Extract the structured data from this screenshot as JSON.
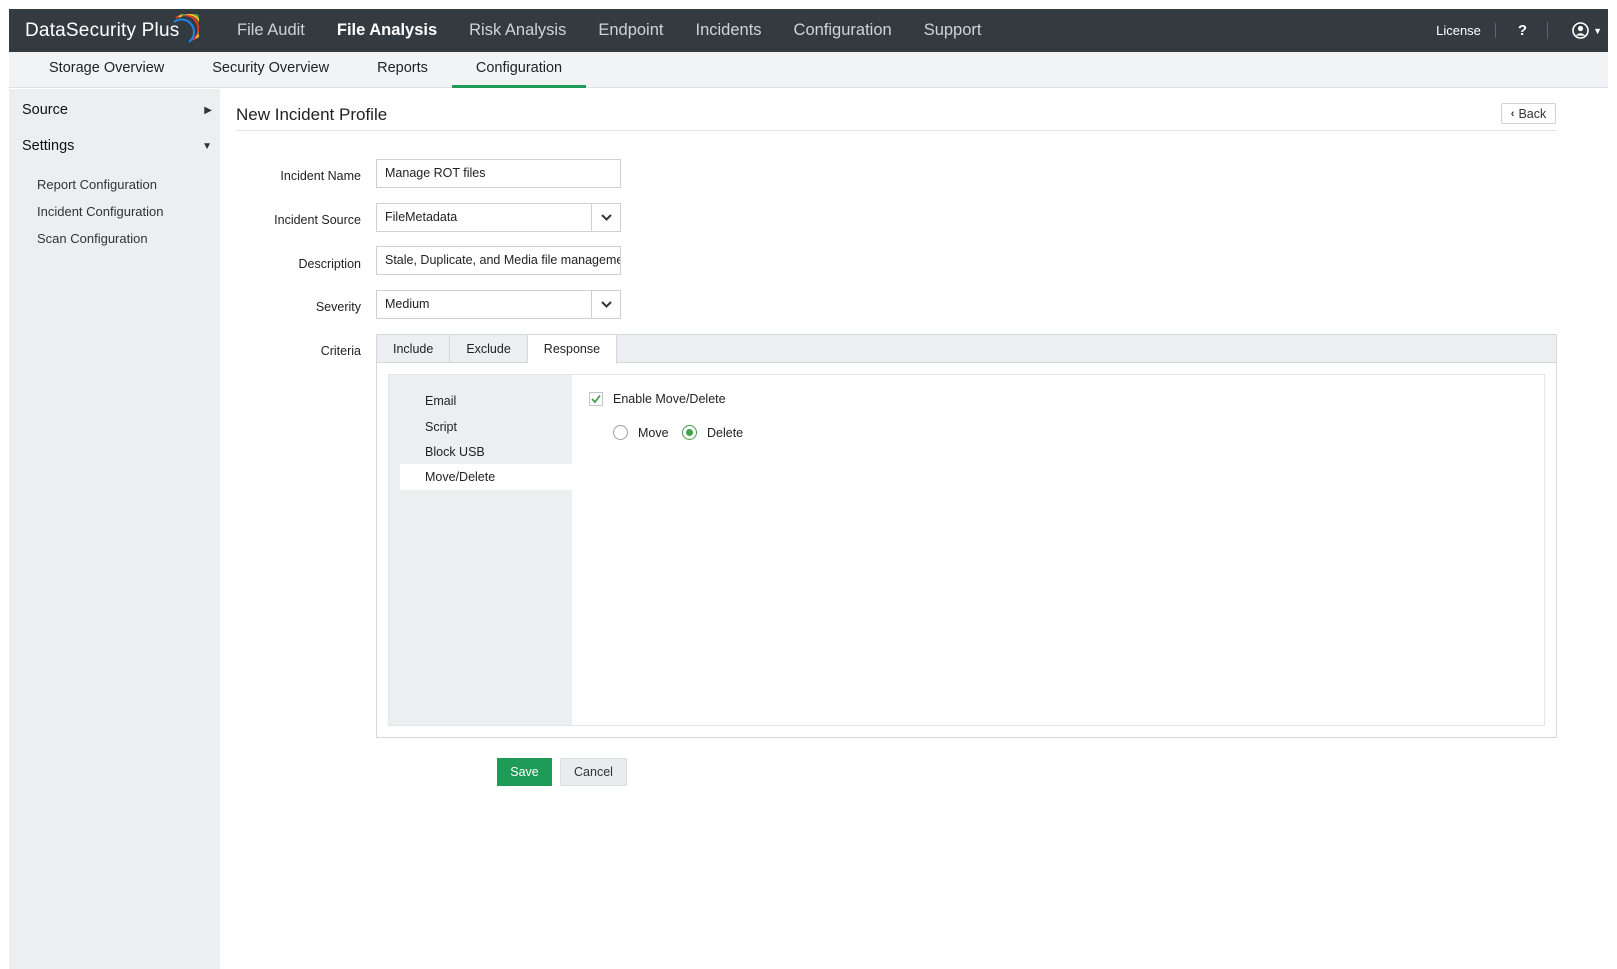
{
  "app": {
    "brand": "DataSecurity Plus"
  },
  "topnav": {
    "items": [
      {
        "label": "File Audit"
      },
      {
        "label": "File Analysis"
      },
      {
        "label": "Risk Analysis"
      },
      {
        "label": "Endpoint"
      },
      {
        "label": "Incidents"
      },
      {
        "label": "Configuration"
      },
      {
        "label": "Support"
      }
    ],
    "active": "File Analysis",
    "license": "License",
    "help": "?"
  },
  "subnav": {
    "items": [
      {
        "label": "Storage Overview"
      },
      {
        "label": "Security Overview"
      },
      {
        "label": "Reports"
      },
      {
        "label": "Configuration"
      }
    ],
    "active": "Configuration"
  },
  "sidebar": {
    "source": "Source",
    "settings": "Settings",
    "links": [
      {
        "label": "Report Configuration"
      },
      {
        "label": "Incident Configuration"
      },
      {
        "label": "Scan Configuration"
      }
    ]
  },
  "page": {
    "title": "New Incident Profile",
    "back": "Back"
  },
  "form": {
    "incident_name_label": "Incident Name",
    "incident_name_value": "Manage ROT files",
    "incident_source_label": "Incident Source",
    "incident_source_value": "FileMetadata",
    "description_label": "Description",
    "description_value": "Stale, Duplicate, and Media file management",
    "severity_label": "Severity",
    "severity_value": "Medium",
    "criteria_label": "Criteria"
  },
  "criteria": {
    "tabs": [
      {
        "label": "Include"
      },
      {
        "label": "Exclude"
      },
      {
        "label": "Response"
      }
    ],
    "active_tab": "Response",
    "responses": [
      {
        "label": "Email"
      },
      {
        "label": "Script"
      },
      {
        "label": "Block USB"
      },
      {
        "label": "Move/Delete"
      }
    ],
    "active_response": "Move/Delete",
    "enable_label": "Enable Move/Delete",
    "enable_checked": true,
    "move_label": "Move",
    "delete_label": "Delete",
    "selected_action": "Delete"
  },
  "actions": {
    "save": "Save",
    "cancel": "Cancel"
  },
  "colors": {
    "topbar": "#333b41",
    "accent_green": "#1e9b56",
    "sidebar_bg": "#eceeef"
  }
}
